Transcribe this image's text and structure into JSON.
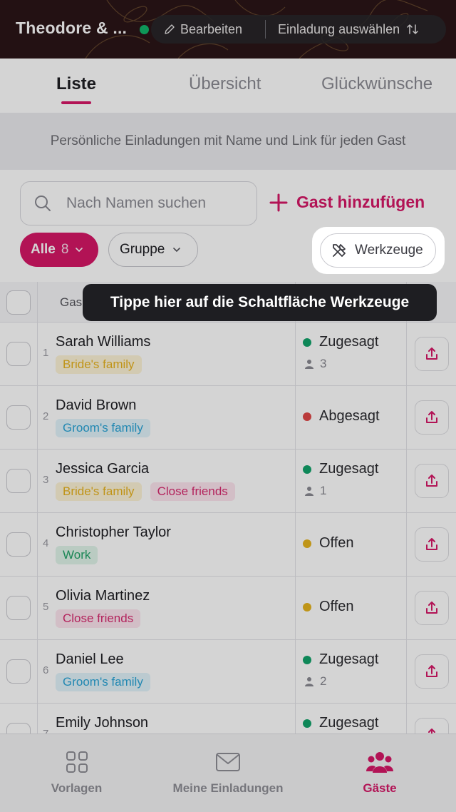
{
  "header": {
    "title": "Theodore & ...",
    "status_color": "#11b66a",
    "edit_label": "Bearbeiten",
    "select_label": "Einladung auswählen"
  },
  "tabs": [
    {
      "label": "Liste",
      "active": true
    },
    {
      "label": "Übersicht",
      "active": false
    },
    {
      "label": "Glückwünsche",
      "active": false
    }
  ],
  "info_text": "Persönliche Einladungen mit Name und Link für jeden Gast",
  "search": {
    "placeholder": "Nach Namen suchen"
  },
  "add_guest_label": "Gast hinzufügen",
  "filters": {
    "all_label": "Alle",
    "all_count": "8",
    "group_label": "Gruppe"
  },
  "tools_label": "Werkzeuge",
  "table": {
    "header_guest": "Gas"
  },
  "tooltip": "Tippe hier auf die Schaltfläche Werkzeuge",
  "guests": [
    {
      "num": "1",
      "name": "Sarah Williams",
      "tags": [
        "Bride's family"
      ],
      "status": "Zugesagt",
      "persons": "3"
    },
    {
      "num": "2",
      "name": "David Brown",
      "tags": [
        "Groom's family"
      ],
      "status": "Abgesagt",
      "persons": ""
    },
    {
      "num": "3",
      "name": "Jessica Garcia",
      "tags": [
        "Bride's family",
        "Close friends"
      ],
      "status": "Zugesagt",
      "persons": "1"
    },
    {
      "num": "4",
      "name": "Christopher Taylor",
      "tags": [
        "Work"
      ],
      "status": "Offen",
      "persons": ""
    },
    {
      "num": "5",
      "name": "Olivia Martinez",
      "tags": [
        "Close friends"
      ],
      "status": "Offen",
      "persons": ""
    },
    {
      "num": "6",
      "name": "Daniel Lee",
      "tags": [
        "Groom's family"
      ],
      "status": "Zugesagt",
      "persons": "2"
    },
    {
      "num": "7",
      "name": "Emily Johnson",
      "tags": [],
      "status": "Zugesagt",
      "persons": ""
    }
  ],
  "status_colors": {
    "Zugesagt": "#11a36a",
    "Abgesagt": "#e04848",
    "Offen": "#e6b41e"
  },
  "accent_color": "#d61767",
  "bottom_nav": [
    {
      "label": "Vorlagen",
      "icon": "grid-icon",
      "active": false
    },
    {
      "label": "Meine Einladungen",
      "icon": "envelope-icon",
      "active": false
    },
    {
      "label": "Gäste",
      "icon": "people-icon",
      "active": true
    }
  ]
}
